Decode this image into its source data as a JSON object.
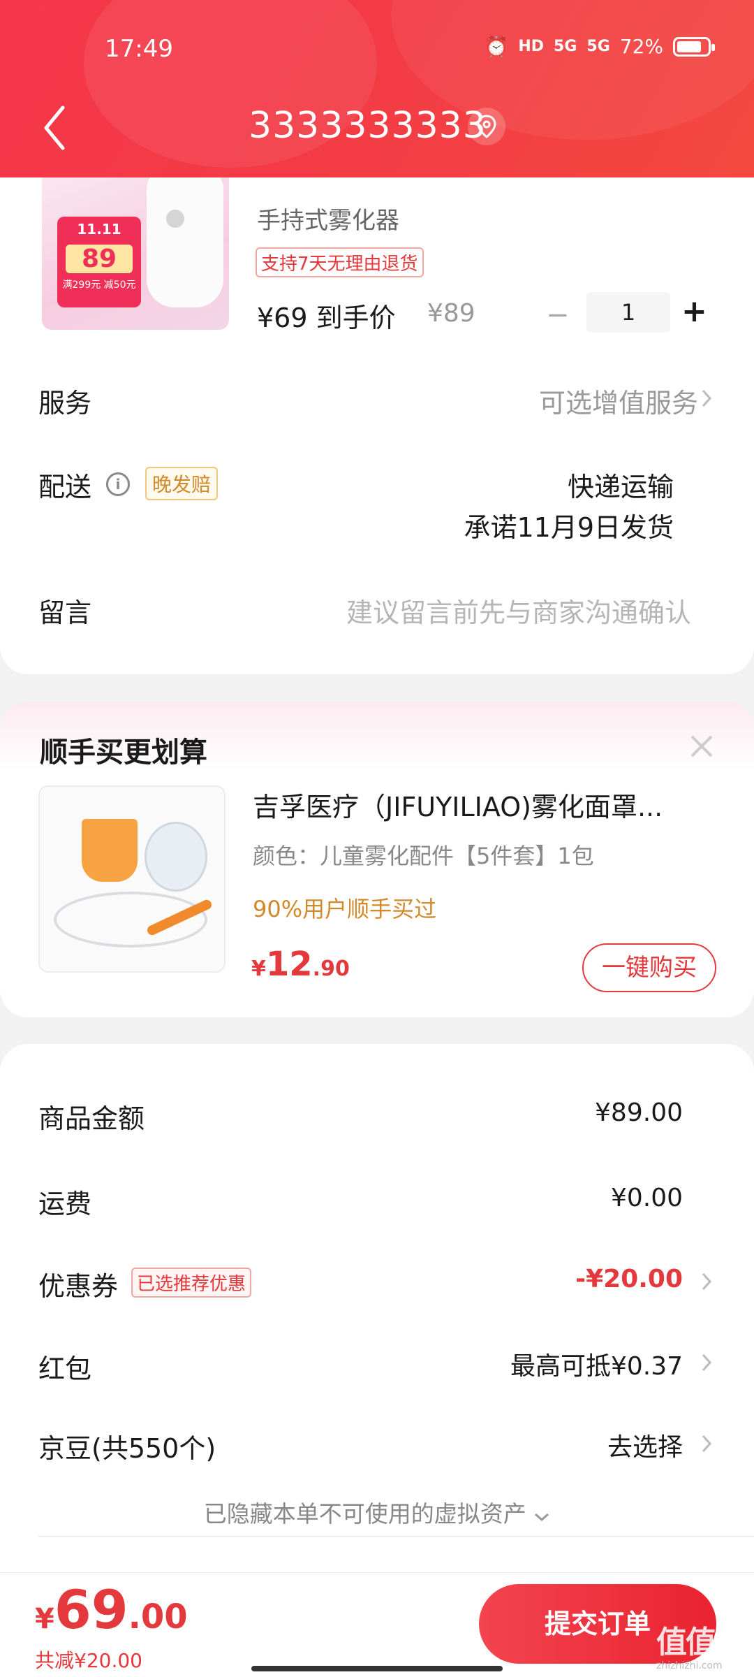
{
  "status_bar": {
    "time": "17:49",
    "hd_label": "HD",
    "signal1_label": "5G",
    "signal2_label": "5G",
    "battery_percent": "72%"
  },
  "header": {
    "phone": "3333333333"
  },
  "product": {
    "name": "手持式雾化器",
    "return_badge": "支持7天无理由退货",
    "final_price": "¥69 到手价",
    "original_price": "¥89",
    "quantity": "1",
    "qty_minus": "−",
    "qty_plus": "+",
    "promo_event": "11.11",
    "promo_price": "89",
    "promo_deal": "满299元 减50元"
  },
  "rows": {
    "service_label": "服务",
    "service_value": "可选增值服务",
    "delivery_label": "配送",
    "delivery_badge": "晚发赔",
    "delivery_method": "快递运输",
    "delivery_promise": "承诺11月9日发货",
    "message_label": "留言",
    "message_placeholder": "建议留言前先与商家沟通确认"
  },
  "upsell": {
    "title": "顺手买更划算",
    "item_name": "吉孚医疗（JIFUYILIAO)雾化面罩...",
    "item_spec": "颜色：儿童雾化配件【5件套】1包",
    "item_social": "90%用户顺手买过",
    "price_currency": "¥",
    "price_int": "12",
    "price_dec": ".90",
    "buy_label": "一键购买"
  },
  "summary": {
    "goods_label": "商品金额",
    "goods_value": "¥89.00",
    "shipping_label": "运费",
    "shipping_value": "¥0.00",
    "coupon_label": "优惠券",
    "coupon_badge": "已选推荐优惠",
    "coupon_value": "-¥20.00",
    "redpacket_label": "红包",
    "redpacket_value": "最高可抵¥0.37",
    "beans_label": "京豆(共550个)",
    "beans_value": "去选择",
    "hidden_note": "已隐藏本单不可使用的虚拟资产"
  },
  "bottom": {
    "currency": "¥",
    "total_int": "69",
    "total_dec": ".00",
    "discount": "共减¥20.00",
    "submit_label": "提交订单",
    "watermark": "值值值",
    "watermark_sub": "zhizhizhi.com"
  },
  "colors": {
    "brand_red": "#e4393c",
    "header_red": "#f33a45",
    "accent_orange": "#d08a2a"
  }
}
